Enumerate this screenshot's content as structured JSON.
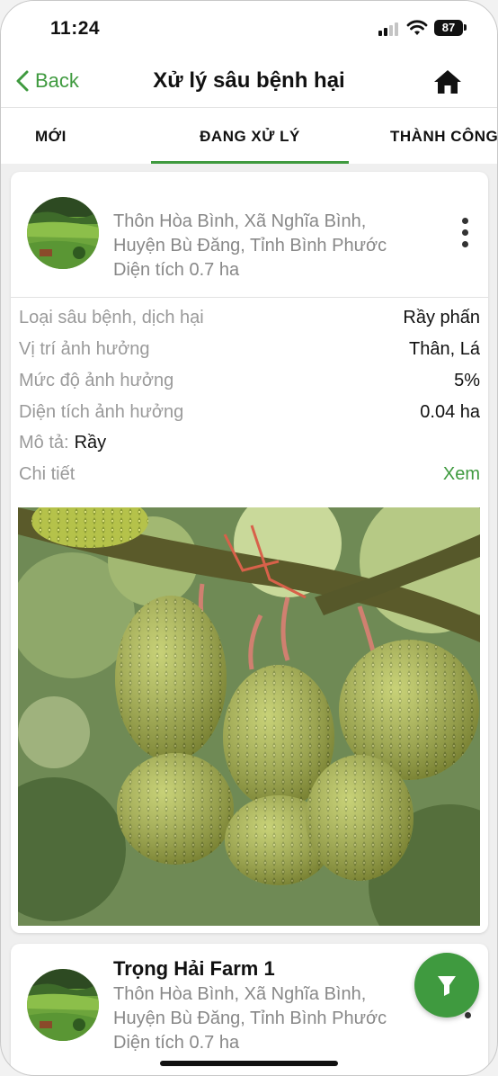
{
  "status_bar": {
    "time": "11:24",
    "battery": "87"
  },
  "nav": {
    "back_label": "Back",
    "title": "Xử lý sâu bệnh hại"
  },
  "tabs": [
    {
      "label": "MỚI"
    },
    {
      "label": "ĐANG XỬ LÝ",
      "active": true
    },
    {
      "label": "THÀNH CÔNG"
    }
  ],
  "card": {
    "address_line1": "Thôn Hòa Bình, Xã Nghĩa Bình,",
    "address_line2": "Huyện Bù Đăng, Tỉnh Bình Phước",
    "area": "Diện tích 0.7 ha",
    "rows": [
      {
        "label": "Loại sâu bệnh, dịch hại",
        "value": "Rầy phấn"
      },
      {
        "label": "Vị trí ảnh hưởng",
        "value": "Thân, Lá"
      },
      {
        "label": "Mức độ ảnh hưởng",
        "value": "5%"
      },
      {
        "label": "Diện tích ảnh hưởng",
        "value": "0.04 ha"
      }
    ],
    "description_label": "Mô tả:",
    "description_value": "Rầy",
    "detail_label": "Chi tiết",
    "detail_link": "Xem"
  },
  "card2": {
    "farm_name": "Trọng Hải Farm 1",
    "address_line1": "Thôn Hòa Bình, Xã Nghĩa Bình,",
    "address_line2": "Huyện Bù Đăng, Tỉnh Bình Phước",
    "area": "Diện tích 0.7 ha"
  },
  "colors": {
    "accent": "#3f9a3f",
    "muted_text": "#9a9a9a"
  },
  "icons": [
    "chevron-left-icon",
    "home-icon",
    "more-vertical-icon",
    "filter-icon",
    "wifi-icon",
    "signal-icon",
    "battery-icon"
  ]
}
